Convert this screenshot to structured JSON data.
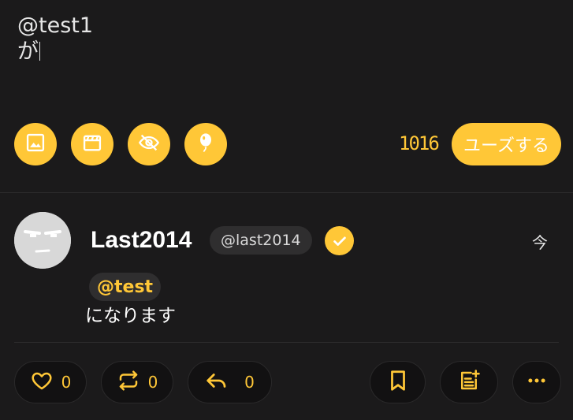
{
  "compose": {
    "line1": "@test1",
    "line2": "が",
    "char_count": "1016",
    "submit_label": "ユーズする",
    "tools": [
      {
        "icon": "image-icon"
      },
      {
        "icon": "video-icon"
      },
      {
        "icon": "eye-off-icon"
      },
      {
        "icon": "balloon-icon"
      }
    ]
  },
  "post": {
    "display_name": "Last2014",
    "handle": "@last2014",
    "time": "今",
    "mention": "@test",
    "text": "になります",
    "actions": {
      "like_count": "0",
      "repost_count": "0",
      "reply_count": "0"
    }
  },
  "colors": {
    "accent": "#ffc737",
    "background": "#1b1a1b"
  }
}
